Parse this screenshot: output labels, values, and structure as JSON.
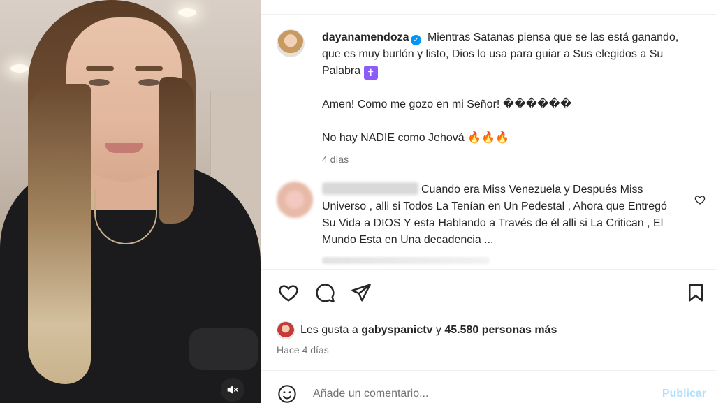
{
  "video": {
    "mute_icon": "speaker-muted-icon"
  },
  "caption": {
    "username": "dayanamendoza",
    "verified_icon": "verified-badge-icon",
    "line1": "Mientras Satanas piensa que se las está ganando, que es muy burlón y listo, Dios lo usa para guiar a Sus elegidos a Su Palabra",
    "cross_emoji": "✝️",
    "line2": "Amen! Como me gozo en mi Señor! ������",
    "line3": "No hay NADIE como Jehová",
    "fire_emojis": "🔥🔥🔥",
    "time": "4 días"
  },
  "comment": {
    "text": "Cuando era Miss Venezuela y Después Miss Universo , alli si Todos La Tenían en Un Pedestal , Ahora que Entregó Su Vida a DIOS Y esta Hablando a Través de él alli si La Critican , El Mundo Esta en Una decadencia ..."
  },
  "actions": {
    "like_icon": "heart-icon",
    "comment_icon": "comment-bubble-icon",
    "share_icon": "paper-plane-icon",
    "save_icon": "bookmark-icon"
  },
  "likes": {
    "prefix": "Les gusta a",
    "user": "gabyspanictv",
    "conj": "y",
    "others": "45.580 personas más"
  },
  "posted": "Hace 4 días",
  "add_comment": {
    "placeholder": "Añade un comentario...",
    "publish_label": "Publicar",
    "emoji_icon": "smiley-icon"
  }
}
